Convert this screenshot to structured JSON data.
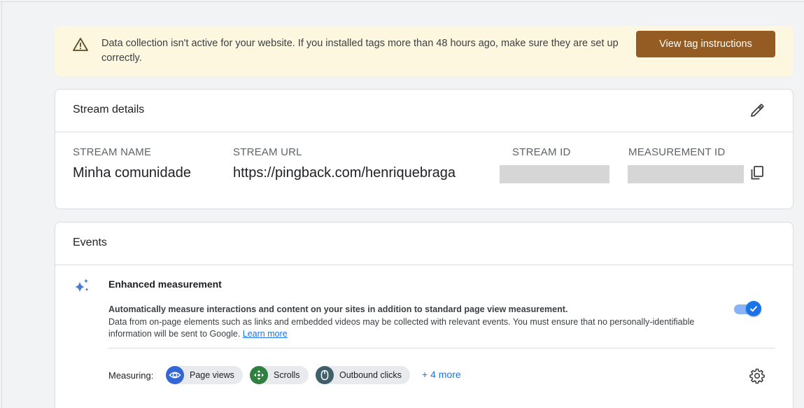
{
  "banner": {
    "message": "Data collection isn't active for your website. If you installed tags more than 48 hours ago, make sure they are set up correctly.",
    "button_label": "View tag instructions",
    "colors": {
      "background": "#fef7e0",
      "button": "#945c22"
    }
  },
  "stream_details": {
    "title": "Stream details",
    "columns": [
      {
        "label": "STREAM NAME",
        "value": "Minha comunidade"
      },
      {
        "label": "STREAM URL",
        "value": "https://pingback.com/henriquebraga"
      },
      {
        "label": "STREAM ID",
        "value": ""
      },
      {
        "label": "MEASUREMENT ID",
        "value": ""
      }
    ],
    "icons": {
      "edit": "pencil-icon",
      "copy": "copy-icon"
    }
  },
  "events": {
    "title": "Events",
    "enhanced": {
      "title": "Enhanced measurement",
      "desc_bold": "Automatically measure interactions and content on your sites in addition to standard page view measurement.",
      "desc": "Data from on-page elements such as links and embedded videos may be collected with relevant events. You must ensure that no personally-identifiable information will be sent to Google.",
      "learn_more": "Learn more",
      "toggle_on": true
    },
    "measuring": {
      "label": "Measuring:",
      "chips": [
        {
          "label": "Page views",
          "icon": "eye-icon",
          "color": "#1a73e8"
        },
        {
          "label": "Scrolls",
          "icon": "scroll-icon",
          "color": "#188038"
        },
        {
          "label": "Outbound clicks",
          "icon": "mouse-icon",
          "color": "#12737a"
        }
      ],
      "more": "+ 4 more"
    },
    "icons": {
      "sparkle": "sparkle-icon",
      "settings": "gear-icon"
    }
  }
}
